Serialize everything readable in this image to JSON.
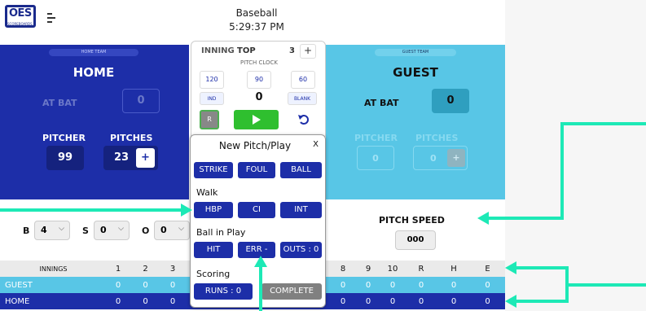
{
  "header": {
    "logo_text": "OES",
    "logo_sub": "SCOREBOARDS",
    "title": "Baseball",
    "time": "5:29:37 PM"
  },
  "home": {
    "tag": "HOME TEAM",
    "name": "HOME",
    "at_bat_label": "AT BAT",
    "at_bat": "0",
    "pitcher_label": "PITCHER",
    "pitches_label": "PITCHES",
    "pitcher": "99",
    "pitches": "23",
    "plus": "+"
  },
  "guest": {
    "tag": "GUEST TEAM",
    "name": "GUEST",
    "at_bat_label": "AT BAT",
    "at_bat": "0",
    "pitcher_label": "PITCHER",
    "pitches_label": "PITCHES",
    "pitcher": "0",
    "pitches": "0",
    "plus": "+"
  },
  "inning": {
    "label": "INNING",
    "half": "TOP",
    "number": "3",
    "plus": "+",
    "pitch_clock_label": "PITCH CLOCK",
    "presets": [
      "120",
      "90",
      "60"
    ],
    "ind": "IND",
    "clock_value": "0",
    "blank": "BLANK",
    "reset": "R"
  },
  "count": {
    "b_label": "B",
    "b": "4",
    "s_label": "S",
    "s": "0",
    "o_label": "O",
    "o": "0"
  },
  "pitch_speed": {
    "label": "PITCH SPEED",
    "value": "000"
  },
  "scoreboard": {
    "innings_label": "INNINGS",
    "columns": [
      "1",
      "2",
      "3",
      "8",
      "9",
      "10",
      "R",
      "H",
      "E"
    ],
    "rows": [
      {
        "name": "GUEST",
        "values": [
          "0",
          "0",
          "0",
          "0",
          "0",
          "0",
          "0",
          "0",
          "0"
        ]
      },
      {
        "name": "HOME",
        "values": [
          "0",
          "0",
          "0",
          "0",
          "0",
          "0",
          "0",
          "0",
          "0"
        ]
      }
    ]
  },
  "popup": {
    "title": "New Pitch/Play",
    "close": "X",
    "pitch_buttons": [
      "STRIKE",
      "FOUL",
      "BALL"
    ],
    "walk_label": "Walk",
    "walk_buttons": [
      "HBP",
      "CI",
      "INT"
    ],
    "ball_in_play_label": "Ball in Play",
    "bip_buttons": [
      "HIT",
      "ERR -",
      "OUTS : 0"
    ],
    "scoring_label": "Scoring",
    "runs": "RUNS : 0",
    "complete": "COMPLETE"
  },
  "colors": {
    "home_blue": "#1d2ea8",
    "guest_cyan": "#58c6e6",
    "play_green": "#2fbf2f",
    "annotation_arrow": "#1de9b6"
  }
}
